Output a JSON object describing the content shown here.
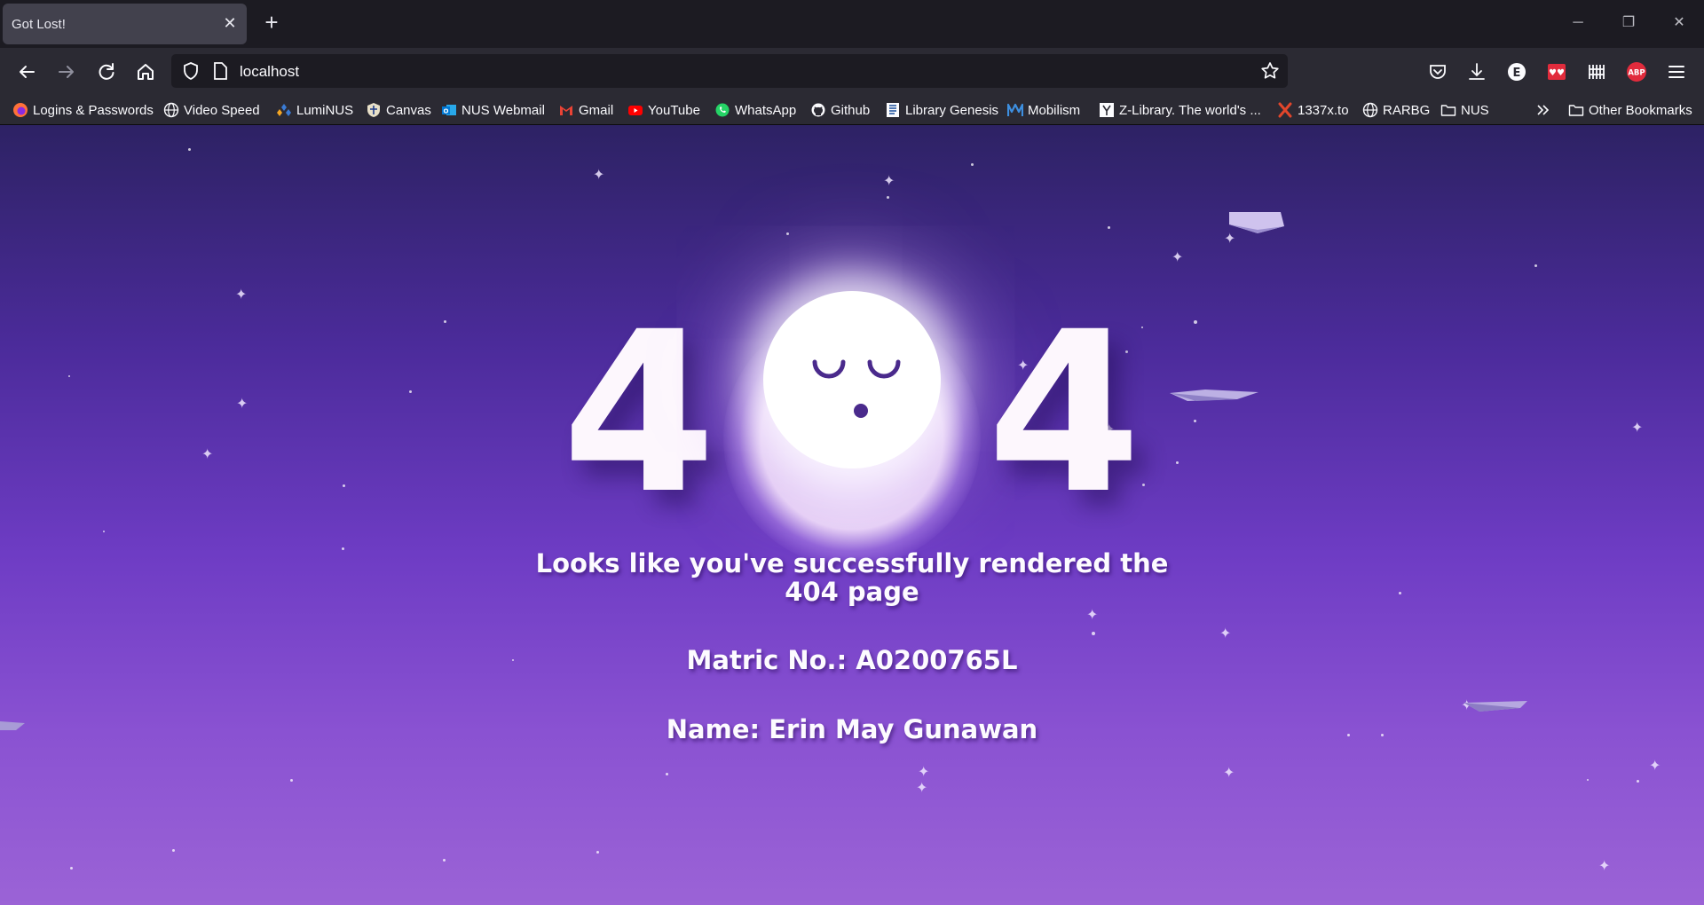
{
  "tab": {
    "title": "Got Lost!"
  },
  "address": {
    "url": "localhost"
  },
  "bookmarks": {
    "items": [
      {
        "label": "Logins & Passwords",
        "icon": "firefox-icon"
      },
      {
        "label": "Video Speed",
        "icon": "globe-icon"
      },
      {
        "label": "LumiNUS",
        "icon": "luminus-icon"
      },
      {
        "label": "Canvas",
        "icon": "canvas-icon"
      },
      {
        "label": "NUS Webmail",
        "icon": "outlook-icon"
      },
      {
        "label": "Gmail",
        "icon": "gmail-icon"
      },
      {
        "label": "YouTube",
        "icon": "youtube-icon"
      },
      {
        "label": "WhatsApp",
        "icon": "whatsapp-icon"
      },
      {
        "label": "Github",
        "icon": "github-icon"
      },
      {
        "label": "Library Genesis",
        "icon": "libgen-icon"
      },
      {
        "label": "Mobilism",
        "icon": "mobilism-icon"
      },
      {
        "label": "Z-Library. The world's ...",
        "icon": "zlibrary-icon"
      },
      {
        "label": "1337x.to",
        "icon": "1337x-icon"
      },
      {
        "label": "RARBG",
        "icon": "globe-icon"
      },
      {
        "label": "NUS",
        "icon": "folder-icon"
      }
    ],
    "other": "Other Bookmarks"
  },
  "page": {
    "digit_left": "4",
    "digit_right": "4",
    "message": "Looks like you've successfully rendered the 404 page",
    "matric": "Matric No.: A0200765L",
    "name": "Name: Erin May Gunawan"
  },
  "colors": {
    "tabbar": "#1c1b22",
    "toolbar": "#2b2a33",
    "page_top": "#2d2264",
    "page_bottom": "#9b63d6",
    "moon_feature": "#4a2a8c",
    "abp_red": "#e12b3c"
  }
}
